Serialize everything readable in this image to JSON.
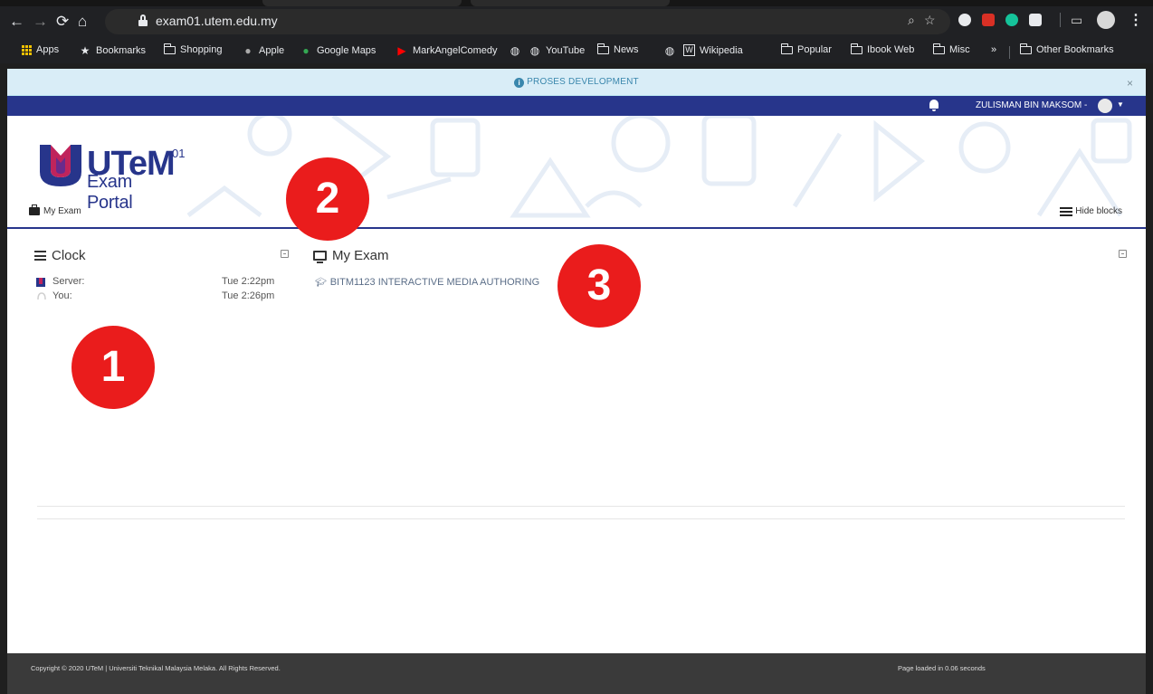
{
  "browser": {
    "url": "exam01.utem.edu.my",
    "bookmarks": [
      "Apps",
      "Bookmarks",
      "Shopping",
      "Apple",
      "Google Maps",
      "MarkAngelComedy",
      "YouTube",
      "News",
      "Wikipedia",
      "Popular",
      "Ibook Web",
      "Misc",
      "Other Bookmarks"
    ],
    "overflow": "»"
  },
  "notice": {
    "text": "PROSES DEVELOPMENT",
    "close": "×"
  },
  "userbar": {
    "username": "ZULISMAN BIN MAKSOM -"
  },
  "header": {
    "logo_main": "UTeM",
    "logo_sup": "01",
    "logo_sub": "Exam Portal",
    "nav_item": "My Exam",
    "hide_blocks": "Hide blocks"
  },
  "clock_block": {
    "title": "Clock",
    "rows": [
      {
        "label": "Server:",
        "time": "Tue 2:22pm"
      },
      {
        "label": "You:",
        "time": "Tue 2:26pm"
      }
    ]
  },
  "myexam_block": {
    "title": "My Exam",
    "courses": [
      "BITM1123 INTERACTIVE MEDIA AUTHORING"
    ]
  },
  "footer": {
    "copyright": "Copyright © 2020 UTeM | Universiti Teknikal Malaysia Melaka. All Rights Reserved.",
    "load_time": "Page loaded in 0.06 seconds"
  },
  "callouts": [
    "1",
    "2",
    "3"
  ],
  "colors": {
    "brand_blue": "#27358b",
    "callout_red": "#ea1c1c",
    "notice_bg": "#d9edf7"
  }
}
